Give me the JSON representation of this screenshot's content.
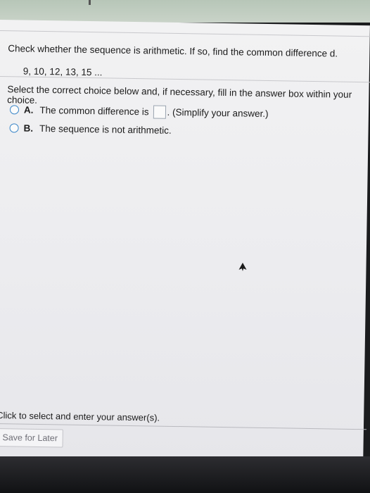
{
  "question": {
    "prompt": "Check whether the sequence is arithmetic. If so, find the common difference d.",
    "sequence": "9, 10, 12, 13, 15 ..."
  },
  "instructions": "Select the correct choice below and, if necessary, fill in the answer box within your choice.",
  "choices": [
    {
      "letter": "A.",
      "text_before": "The common difference is",
      "text_after": ". (Simplify your answer.)",
      "answer": ""
    },
    {
      "letter": "B.",
      "text": "The sequence is not arithmetic."
    }
  ],
  "footer": {
    "message": "Click to select and enter your answer(s).",
    "save_label": "Save for Later"
  },
  "colors": {
    "radio_border": "#3a86c8",
    "page_bg": "#efeff1"
  }
}
